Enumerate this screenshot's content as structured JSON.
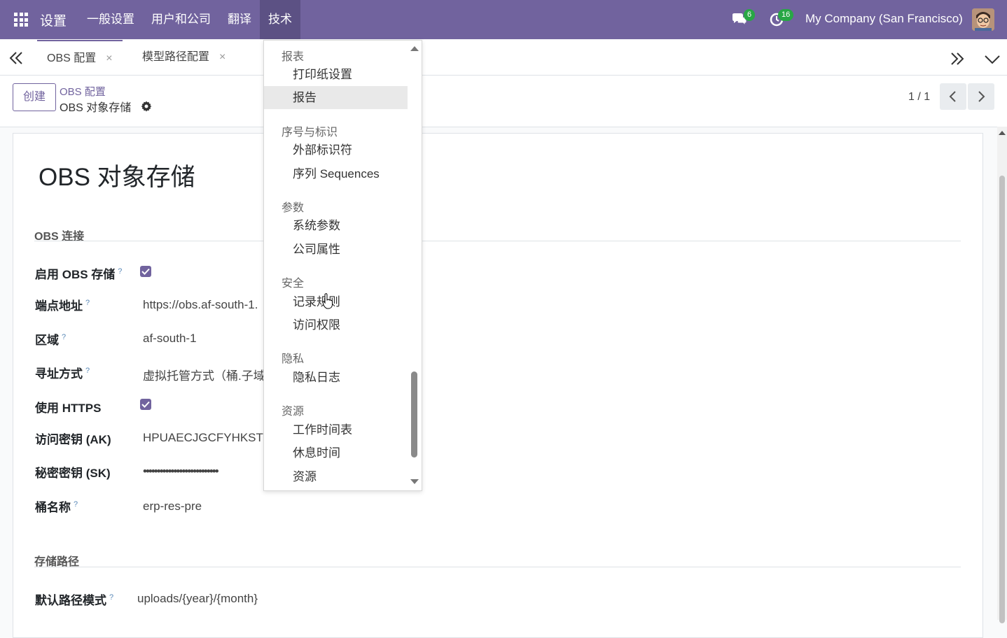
{
  "navbar": {
    "brand": "设置",
    "menu": [
      "一般设置",
      "用户和公司",
      "翻译",
      "技术"
    ],
    "active_menu": "技术",
    "messages_count": "6",
    "activities_count": "16",
    "company": "My Company (San Francisco)"
  },
  "tabs": [
    {
      "label": "OBS 配置",
      "close": "×"
    },
    {
      "label": "模型路径配置",
      "close": "×"
    }
  ],
  "control": {
    "create_label": "创建",
    "breadcrumb_parent": "OBS 配置",
    "breadcrumb_current": "OBS 对象存储",
    "pager": "1 / 1"
  },
  "form": {
    "title": "OBS 对象存储",
    "section_connection": "OBS 连接",
    "section_storage": "存储路径",
    "fields": {
      "enable_obs": {
        "label": "启用 OBS 存储",
        "help": "?",
        "checked": true
      },
      "endpoint": {
        "label": "端点地址",
        "help": "?",
        "value": "https://obs.af-south-1."
      },
      "region": {
        "label": "区域",
        "help": "?",
        "value": "af-south-1"
      },
      "addressing": {
        "label": "寻址方式",
        "help": "?",
        "value": "虚拟托管方式（桶.子域"
      },
      "use_https": {
        "label": "使用 HTTPS",
        "checked": true
      },
      "access_key": {
        "label": "访问密钥 (AK)",
        "value": "HPUAECJGCFYHKSTZF"
      },
      "secret_key": {
        "label": "秘密密钥 (SK)",
        "value": "•••••••••••••••••••••••••••"
      },
      "bucket": {
        "label": "桶名称",
        "help": "?",
        "value": "erp-res-pre"
      },
      "default_path": {
        "label": "默认路径模式",
        "help": "?",
        "value": "uploads/{year}/{month}"
      }
    }
  },
  "dropdown": {
    "groups": [
      {
        "header": "报表",
        "items": [
          "打印纸设置",
          "报告"
        ]
      },
      {
        "header": "序号与标识",
        "items": [
          "外部标识符",
          "序列 Sequences"
        ]
      },
      {
        "header": "参数",
        "items": [
          "系统参数",
          "公司属性"
        ]
      },
      {
        "header": "安全",
        "items": [
          "记录规则",
          "访问权限"
        ]
      },
      {
        "header": "隐私",
        "items": [
          "隐私日志"
        ]
      },
      {
        "header": "资源",
        "items": [
          "工作时间表",
          "休息时间",
          "资源"
        ]
      }
    ],
    "hovered_item": "报告"
  },
  "colors": {
    "primary": "#71639e",
    "badge": "#28a745"
  }
}
